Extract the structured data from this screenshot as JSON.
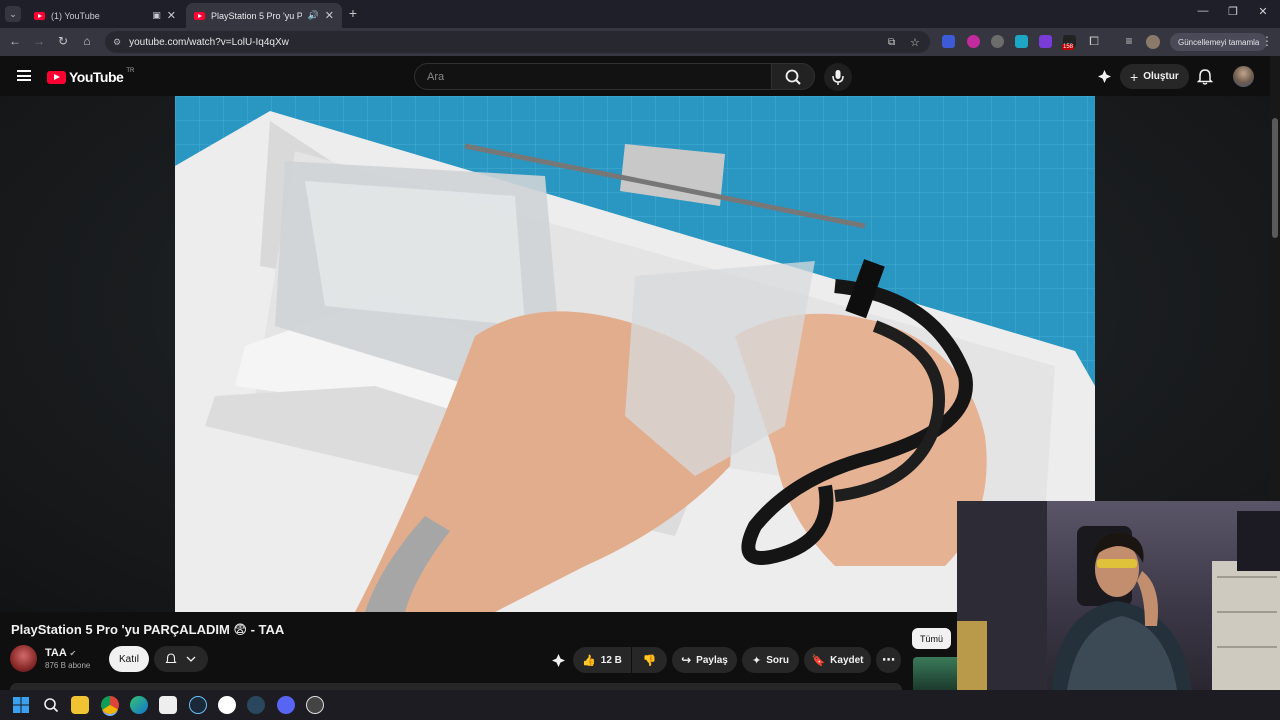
{
  "browser": {
    "tabs": [
      {
        "label": "(1) YouTube",
        "active": false
      },
      {
        "label": "PlayStation 5 Pro 'yu PARÇA",
        "active": true
      }
    ],
    "new_tab": "+",
    "url": "youtube.com/watch?v=LolU-Iq4qXw",
    "update_label": "Güncellemeyi tamamla",
    "ext_badge": "158"
  },
  "youtube": {
    "logo_text": "YouTube",
    "region": "TR",
    "search_placeholder": "Ara",
    "create_label": "Oluştur"
  },
  "video": {
    "title": "PlayStation 5 Pro 'yu PARÇALADIM 😨 - TAA",
    "channel": "TAA",
    "subscribers": "876 B abone",
    "join_label": "Katıl",
    "like_count": "12 B",
    "share_label": "Paylaş",
    "ask_label": "Soru",
    "save_label": "Kaydet",
    "filter_all": "Tümü"
  },
  "colors": {
    "brand_red": "#ff0033",
    "page_bg": "#0f0f0f",
    "pill_bg": "#272727"
  }
}
